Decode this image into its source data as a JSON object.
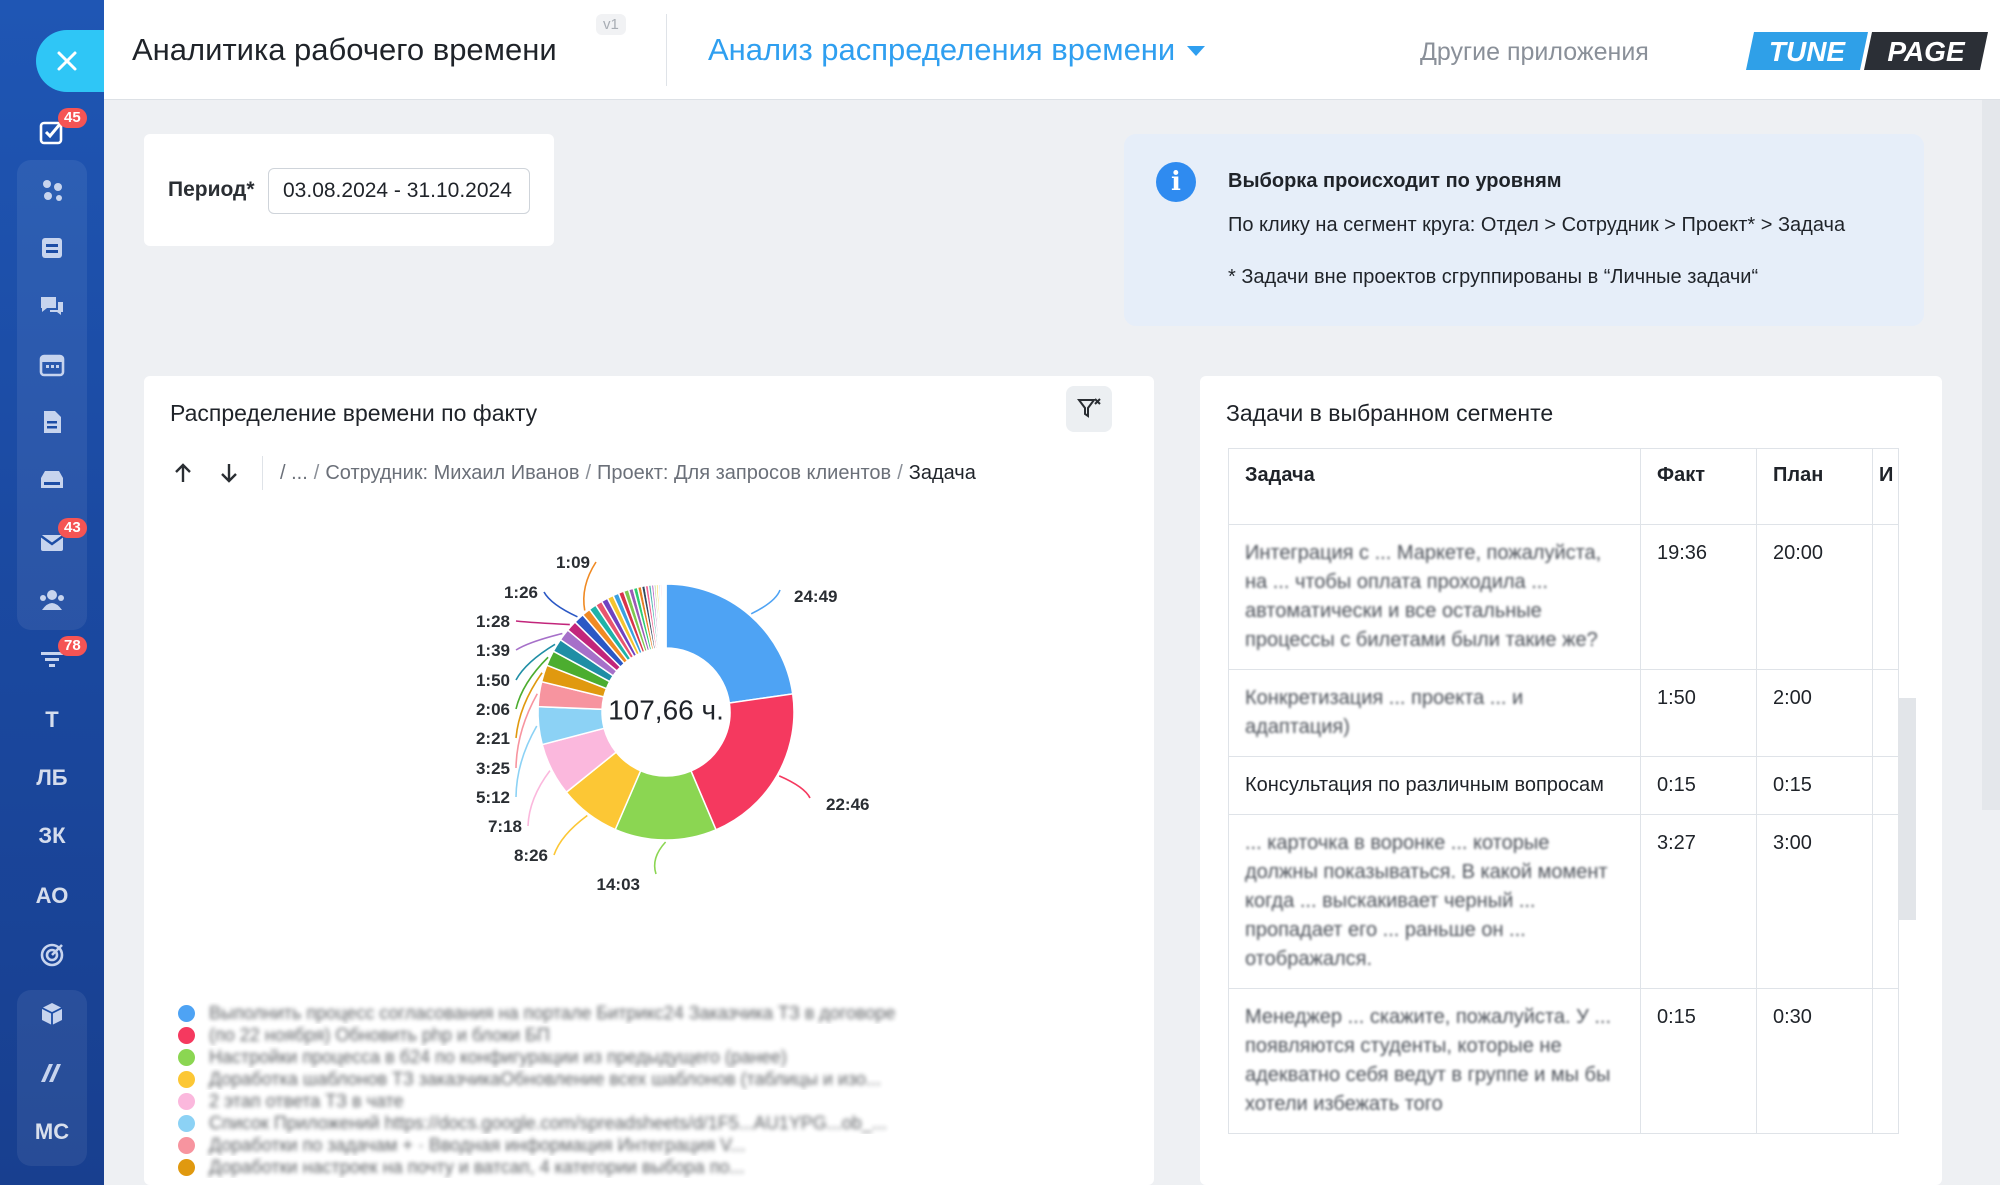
{
  "rail": {
    "items": [
      {
        "name": "tasks-icon",
        "badge": "45"
      },
      {
        "name": "crm-icon",
        "badge": ""
      },
      {
        "name": "sites-icon",
        "badge": ""
      },
      {
        "name": "chat-icon",
        "badge": ""
      },
      {
        "name": "calendar-icon",
        "badge": ""
      },
      {
        "name": "document-icon",
        "badge": ""
      },
      {
        "name": "storage-icon",
        "badge": ""
      },
      {
        "name": "mail-icon",
        "badge": "43"
      },
      {
        "name": "employees-icon",
        "badge": ""
      },
      {
        "name": "filter-funnel-icon",
        "badge": "78"
      },
      {
        "name": "text",
        "label": "Т"
      },
      {
        "name": "text",
        "label": "ЛБ"
      },
      {
        "name": "text",
        "label": "ЗК"
      },
      {
        "name": "text",
        "label": "АО"
      },
      {
        "name": "target-icon",
        "badge": ""
      },
      {
        "name": "box-icon",
        "badge": ""
      },
      {
        "name": "market-icon",
        "badge": ""
      },
      {
        "name": "text",
        "label": "МС"
      }
    ]
  },
  "header": {
    "app_title": "Аналитика рабочего времени",
    "version": "v1",
    "view_title": "Анализ распределения времени",
    "other_apps": "Другие приложения",
    "logo_left": "TUNE",
    "logo_right": "PAGE"
  },
  "period": {
    "label": "Период*",
    "value": "03.08.2024 - 31.10.2024"
  },
  "info": {
    "title": "Выборка происходит по уровням",
    "line1": "По клику на сегмент круга: Отдел > Сотрудник > Проект* > Задача",
    "line2": "* Задачи вне проектов сгруппированы в “Личные задачи“"
  },
  "chart": {
    "title": "Распределение времени по факту",
    "breadcrumb": {
      "root": "/ ...",
      "employee": "Сотрудник: Михаил Иванов",
      "project": "Проект: Для запросов клиентов",
      "current": "Задача"
    },
    "total_label": "107,66 ч."
  },
  "chart_data": {
    "type": "pie",
    "center_label": "107,66 ч.",
    "slices": [
      {
        "label": "24:49",
        "value": 24.82,
        "color": "#4ea3f4"
      },
      {
        "label": "22:46",
        "value": 22.77,
        "color": "#f5395f"
      },
      {
        "label": "14:03",
        "value": 14.05,
        "color": "#8bd652"
      },
      {
        "label": "8:26",
        "value": 8.43,
        "color": "#fcc735"
      },
      {
        "label": "7:18",
        "value": 7.3,
        "color": "#fbb8dd"
      },
      {
        "label": "5:12",
        "value": 5.2,
        "color": "#8cd2f5"
      },
      {
        "label": "3:25",
        "value": 3.42,
        "color": "#f7949f"
      },
      {
        "label": "2:21",
        "value": 2.35,
        "color": "#e0990f"
      },
      {
        "label": "2:06",
        "value": 2.1,
        "color": "#4cad2f"
      },
      {
        "label": "1:50",
        "value": 1.83,
        "color": "#1f8ea5"
      },
      {
        "label": "1:39",
        "value": 1.65,
        "color": "#a670c9"
      },
      {
        "label": "1:28",
        "value": 1.47,
        "color": "#c2257b"
      },
      {
        "label": "1:26",
        "value": 1.43,
        "color": "#2b58c5"
      },
      {
        "label": "1:09",
        "value": 1.15,
        "color": "#f08a23"
      },
      {
        "label": "",
        "value": 1.05,
        "color": "#1fb3a8"
      },
      {
        "label": "",
        "value": 0.95,
        "color": "#e8556e"
      },
      {
        "label": "",
        "value": 0.9,
        "color": "#6f42c1"
      },
      {
        "label": "",
        "value": 0.85,
        "color": "#f4c430"
      },
      {
        "label": "",
        "value": 0.8,
        "color": "#3aa0e0"
      },
      {
        "label": "",
        "value": 0.75,
        "color": "#d8334a"
      },
      {
        "label": "",
        "value": 0.7,
        "color": "#7ec850"
      },
      {
        "label": "",
        "value": 0.65,
        "color": "#9b59b6"
      },
      {
        "label": "",
        "value": 0.6,
        "color": "#2ecc71"
      },
      {
        "label": "",
        "value": 0.55,
        "color": "#e67e22"
      },
      {
        "label": "",
        "value": 0.5,
        "color": "#34495e"
      },
      {
        "label": "",
        "value": 0.45,
        "color": "#f06292"
      },
      {
        "label": "",
        "value": 0.4,
        "color": "#4db6ac"
      },
      {
        "label": "",
        "value": 0.35,
        "color": "#ba68c8"
      },
      {
        "label": "",
        "value": 0.3,
        "color": "#aed581"
      },
      {
        "label": "",
        "value": 0.3,
        "color": "#ffd54f"
      },
      {
        "label": "",
        "value": 0.25,
        "color": "#90caf9"
      },
      {
        "label": "",
        "value": 0.25,
        "color": "#f8bbd0"
      },
      {
        "label": "",
        "value": 0.2,
        "color": "#e0e0e0"
      },
      {
        "label": "",
        "value": 0.2,
        "color": "#ffcc80"
      },
      {
        "label": "",
        "value": 0.15,
        "color": "#cfd8dc"
      }
    ]
  },
  "legend": [
    {
      "color": "#4ea3f4",
      "text": "Выполнить процесс согласования на портале Битрикс24 Заказчика ТЗ в договоре"
    },
    {
      "color": "#f5395f",
      "text": "(по 22 ноября) Обновить php и блоки БП"
    },
    {
      "color": "#8bd652",
      "text": "Настройки процесса в б24 по конфигурации из предыдущего (ранее)"
    },
    {
      "color": "#fcc735",
      "text": "Доработка шаблонов ТЗ заказчикаОбновление всех шаблонов (таблицы и изо..."
    },
    {
      "color": "#fbb8dd",
      "text": "2 этап ответа ТЗ в чате"
    },
    {
      "color": "#8cd2f5",
      "text": "Список Приложений https://docs.google.com/spreadsheets/d/1F5...AU1YPG...ob_..."
    },
    {
      "color": "#f7949f",
      "text": "Доработки по задачам +   ·   Вводная информация      Интеграция V..."
    },
    {
      "color": "#e0990f",
      "text": "Доработки настроек на почту и ватсап, 4 категории выбора по..."
    }
  ],
  "tasks": {
    "title": "Задачи в выбранном сегменте",
    "columns": [
      "Задача",
      "Факт",
      "План",
      "И"
    ],
    "rows": [
      {
        "task": "Интеграция с ... Маркете, пожалуйста, на ... чтобы оплата проходила ... автоматически и все остальные процессы с билетами были такие же?",
        "fact": "19:36",
        "plan": "20:00",
        "blurred": true
      },
      {
        "task": "Конкретизация ... проекта ... и адаптация)",
        "fact": "1:50",
        "plan": "2:00",
        "blurred": true
      },
      {
        "task": "Консультация по различным вопросам",
        "fact": "0:15",
        "plan": "0:15",
        "blurred": false
      },
      {
        "task": "... карточка в воронке ... которые должны показываться. В какой момент когда ... выскакивает черный ... пропадает его ... раньше он ... отображался.",
        "fact": "3:27",
        "plan": "3:00",
        "blurred": true
      },
      {
        "task": "Менеджер ... скажите, пожалуйста. У ... появляются студенты, которые не адекватно себя ведут в группе и мы бы хотели избежать того",
        "fact": "0:15",
        "plan": "0:30",
        "blurred": true
      }
    ]
  }
}
